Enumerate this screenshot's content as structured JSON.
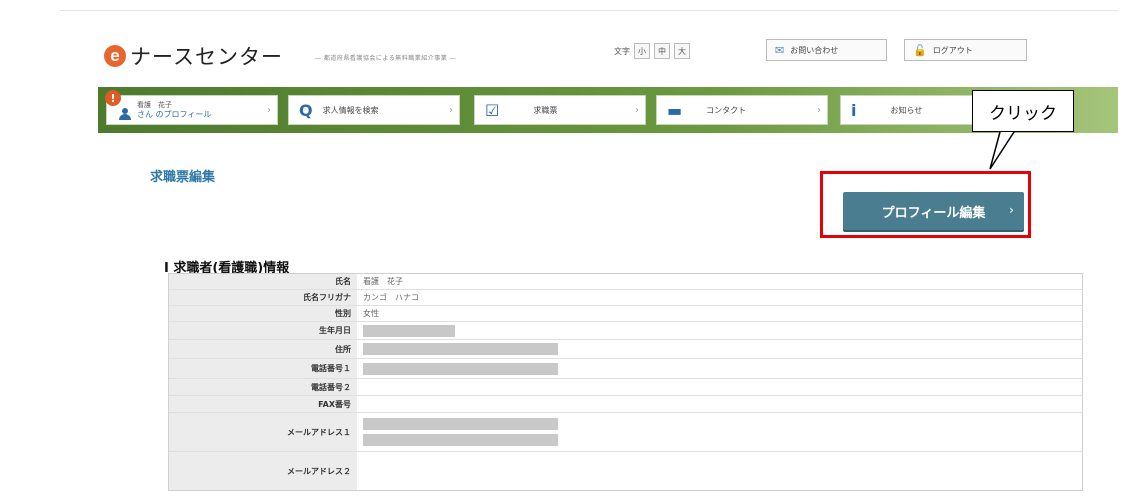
{
  "header": {
    "logo_letter": "e",
    "logo_text": "ナースセンター",
    "tagline": "― 都道府県看護協会による無料職業紹介事業 ―",
    "fontsize_label": "文字",
    "fontsize_options": [
      "小",
      "中",
      "大"
    ],
    "contact_button": "お問い合わせ",
    "logout_button": "ログアウト"
  },
  "nav": {
    "profile_badge": "!",
    "profile_name": "看護　花子",
    "profile_link": "さん のプロフィール",
    "items": [
      {
        "icon": "search-icon",
        "glyph": "Q",
        "label": "求人情報を検索"
      },
      {
        "icon": "edit-icon",
        "glyph": "☑",
        "label": "求職票"
      },
      {
        "icon": "chat-icon",
        "glyph": "▬",
        "label": "コンタクト"
      },
      {
        "icon": "info-icon",
        "glyph": "i",
        "label": "お知らせ"
      }
    ]
  },
  "callout": {
    "text": "クリック"
  },
  "page_title": "求職票編集",
  "edit_button": "プロフィール編集",
  "section": {
    "title": "I 求職者(看護職)情報",
    "rows": [
      {
        "label": "氏名",
        "value": "看護　花子"
      },
      {
        "label": "氏名フリガナ",
        "value": "カンゴ　ハナコ"
      },
      {
        "label": "性別",
        "value": "女性"
      },
      {
        "label": "生年月日",
        "value": ""
      },
      {
        "label": "住所",
        "value": ""
      },
      {
        "label": "電話番号１",
        "value": ""
      },
      {
        "label": "電話番号２",
        "value": ""
      },
      {
        "label": "FAX番号",
        "value": ""
      },
      {
        "label": "メールアドレス１",
        "value": ""
      },
      {
        "label": "メールアドレス２",
        "value": ""
      }
    ]
  },
  "colors": {
    "accent": "#2f7aa8",
    "button": "#4a7d8f",
    "highlight": "#e6000a",
    "nav_green": "#5b8a34",
    "logo": "#e8662e"
  }
}
